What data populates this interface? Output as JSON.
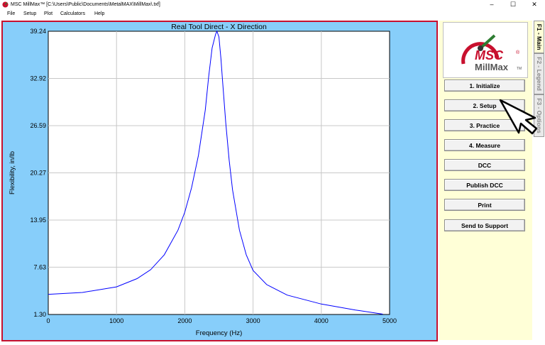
{
  "window": {
    "title": "MSC MillMax™  [C:\\Users\\Public\\Documents\\MetalMAX\\MillMax\\.txf]",
    "minimize_glyph": "–",
    "maximize_glyph": "☐",
    "close_glyph": "✕"
  },
  "menu": [
    "File",
    "Setup",
    "Plot",
    "Calculators",
    "Help"
  ],
  "logo": {
    "brand": "MSC",
    "product": "MillMax",
    "tm": "TM",
    "registered": "®"
  },
  "buttons": [
    "1. Initialize",
    "2. Setup",
    "3. Practice",
    "4. Measure",
    "DCC",
    "Publish DCC",
    "Print",
    "Send to Support"
  ],
  "tabs": [
    "F1 - Main",
    "F2 - Legend",
    "F3 - Options"
  ],
  "colors": {
    "accent_red": "#c8102e",
    "plot_bg": "#87cefa",
    "panel_bg": "#ffffd7",
    "curve": "#0000ff"
  },
  "chart_data": {
    "type": "line",
    "title": "Real Tool Direct - X Direction",
    "xlabel": "Frequency (Hz)",
    "ylabel": "Flexibility, in/lb",
    "xlim": [
      0,
      5000
    ],
    "ylim": [
      1.3,
      39.24
    ],
    "xticks": [
      0,
      1000,
      2000,
      3000,
      4000,
      5000
    ],
    "yticks": [
      1.3,
      7.63,
      13.95,
      20.27,
      26.59,
      32.92,
      39.24
    ],
    "ytick_labels": [
      "1.30",
      "7.63",
      "13.95",
      "20.27",
      "26.59",
      "32.92",
      "39.24"
    ],
    "grid": true,
    "series": [
      {
        "x": [
          0,
          500,
          1000,
          1300,
          1500,
          1700,
          1900,
          2000,
          2100,
          2200,
          2300,
          2350,
          2400,
          2450,
          2470,
          2500,
          2530,
          2550,
          2600,
          2650,
          2700,
          2800,
          2900,
          3000,
          3200,
          3500,
          4000,
          4500,
          4900
        ],
        "y": [
          4.0,
          4.25,
          5.0,
          6.1,
          7.3,
          9.3,
          12.6,
          15.0,
          18.3,
          22.6,
          28.7,
          33.2,
          37.0,
          38.8,
          39.24,
          38.5,
          35.5,
          33.0,
          27.0,
          22.0,
          18.0,
          12.6,
          9.3,
          7.2,
          5.3,
          3.9,
          2.7,
          1.9,
          1.35
        ]
      }
    ]
  }
}
